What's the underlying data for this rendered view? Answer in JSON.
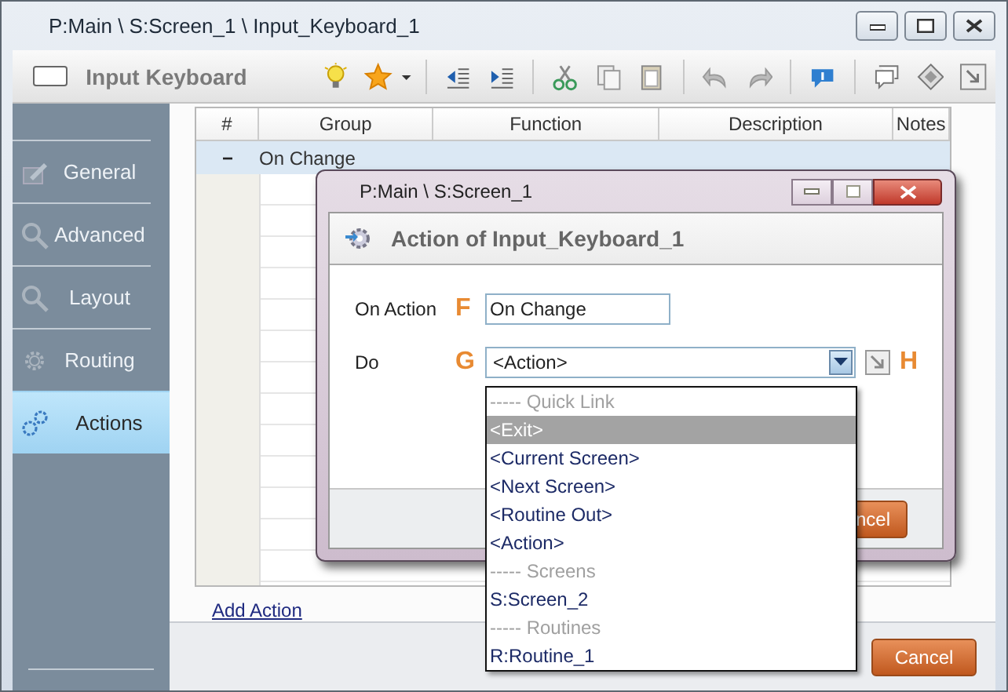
{
  "window": {
    "title": "P:Main \\ S:Screen_1 \\ Input_Keyboard_1"
  },
  "toolbar": {
    "title": "Input Keyboard"
  },
  "sidebar": {
    "items": [
      {
        "label": "General",
        "selected": false
      },
      {
        "label": "Advanced",
        "selected": false
      },
      {
        "label": "Layout",
        "selected": false
      },
      {
        "label": "Routing",
        "selected": false
      },
      {
        "label": "Actions",
        "selected": true
      }
    ]
  },
  "table": {
    "columns": [
      "#",
      "Group",
      "Function",
      "Description",
      "Notes"
    ],
    "groups": [
      {
        "toggle": "−",
        "label": "On Change"
      }
    ]
  },
  "add_action_link": "Add Action",
  "footer": {
    "cancel_button": "Cancel"
  },
  "dialog": {
    "title": "P:Main \\ S:Screen_1",
    "heading": "Action of Input_Keyboard_1",
    "fields": [
      {
        "kind": "text",
        "label": "On Action",
        "marker": "F",
        "value": "On Change"
      },
      {
        "kind": "select",
        "label": "Do",
        "marker": "G",
        "value": "<Action>",
        "side_marker": "H"
      }
    ],
    "cancel_button": "ncel"
  },
  "dropdown": {
    "items": [
      {
        "kind": "header",
        "label": "----- Quick Link",
        "selected": false
      },
      {
        "kind": "option",
        "label": "<Exit>",
        "selected": true
      },
      {
        "kind": "option",
        "label": "<Current Screen>",
        "selected": false
      },
      {
        "kind": "option",
        "label": "<Next Screen>",
        "selected": false
      },
      {
        "kind": "option",
        "label": "<Routine Out>",
        "selected": false
      },
      {
        "kind": "option",
        "label": "<Action>",
        "selected": false
      },
      {
        "kind": "header",
        "label": "----- Screens",
        "selected": false
      },
      {
        "kind": "option",
        "label": "S:Screen_2",
        "selected": false
      },
      {
        "kind": "header",
        "label": "----- Routines",
        "selected": false
      },
      {
        "kind": "option",
        "label": "R:Routine_1",
        "selected": false
      }
    ]
  }
}
